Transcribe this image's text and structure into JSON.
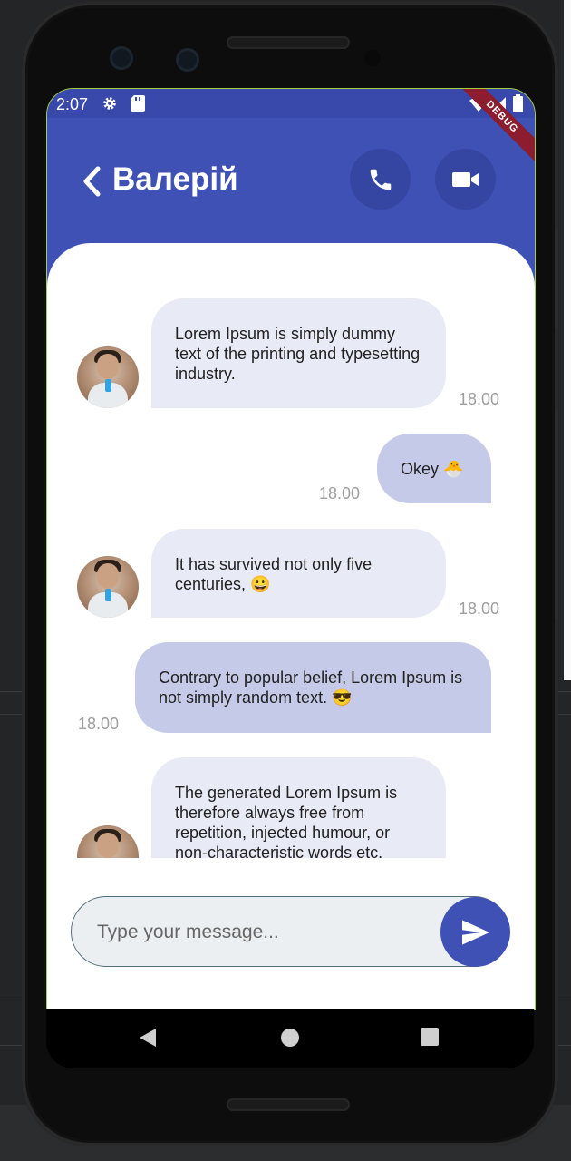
{
  "status_bar": {
    "time": "2:07",
    "debug_banner": "DEBUG"
  },
  "header": {
    "contact_name": "Валерій"
  },
  "messages": [
    {
      "direction": "incoming",
      "text": "Lorem Ipsum is simply dummy text of the printing and typesetting industry.",
      "time": "18.00"
    },
    {
      "direction": "outgoing",
      "text": "Okey 🐣",
      "time": "18.00"
    },
    {
      "direction": "incoming",
      "text": "It has survived not only five centuries, 😀",
      "time": "18.00"
    },
    {
      "direction": "outgoing",
      "text": "Contrary to popular belief, Lorem Ipsum is not simply random text. 😎",
      "time": "18.00"
    },
    {
      "direction": "incoming",
      "text": "The generated Lorem Ipsum is therefore always free from repetition, injected humour, or non-characteristic words etc.",
      "time": ""
    }
  ],
  "composer": {
    "placeholder": "Type your message...",
    "value": ""
  },
  "colors": {
    "primary": "#3f51b5",
    "status_bar": "#3949ab",
    "incoming_bubble": "#e8eaf6",
    "outgoing_bubble": "#c5cae9",
    "timestamp": "#9e9e9e"
  },
  "icons": {
    "back": "chevron-left-icon",
    "call": "phone-icon",
    "video": "video-camera-icon",
    "send": "send-icon",
    "nav_back": "triangle-back-icon",
    "nav_home": "circle-home-icon",
    "nav_recents": "square-recents-icon"
  }
}
